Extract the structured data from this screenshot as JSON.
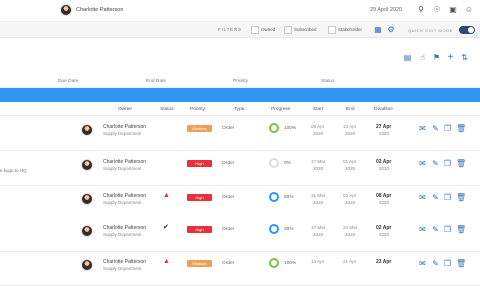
{
  "header": {
    "user_name": "Charlotte Patterson",
    "date": "29 April 2020"
  },
  "filterbar": {
    "label": "FILTERS",
    "options": [
      "Owned",
      "Subscribed",
      "Stakeholder"
    ],
    "quick_edit_label": "QUICK EDIT MODE"
  },
  "columns_strip": {
    "due_date": "Due Date",
    "end_date": "End Date",
    "priority": "Priority",
    "status": "Status"
  },
  "table": {
    "headers": {
      "owner": "Owner",
      "status": "Status",
      "priority": "Priority",
      "type": "Type",
      "progress": "Progress",
      "start": "Start",
      "end": "End",
      "deadline": "Deadline"
    },
    "rows": [
      {
        "desc": "",
        "owner": "Charlotte Patterson",
        "dept": "Supply Department",
        "status": "",
        "priority": "Medium",
        "priority_color": "#f0a05a",
        "type": "Order",
        "progress": "100%",
        "progress_ring_color": "#7bc142",
        "start": "06 Apr",
        "start_year": "2020",
        "end": "13 Apr",
        "end_year": "2020",
        "deadline": "27 Apr",
        "deadline_year": "2020"
      },
      {
        "desc": "e kugo to HQ",
        "owner": "Charlotte Patterson",
        "dept": "Supply Department",
        "status": "",
        "priority": "High",
        "priority_color": "#e8303c",
        "type": "Order",
        "progress": "0%",
        "progress_ring_color": "#dddddd",
        "start": "17 Mar",
        "start_year": "2020",
        "end": "01 Apr",
        "end_year": "2020",
        "deadline": "02 Apr",
        "deadline_year": "2020"
      },
      {
        "desc": "",
        "owner": "Charlotte Patterson",
        "dept": "Supply Department",
        "status": "▲",
        "priority": "High",
        "priority_color": "#e8303c",
        "type": "Order",
        "progress": "50%",
        "progress_ring_color": "#2f96f3",
        "start": "31 Mar",
        "start_year": "2020",
        "end": "03 Apr",
        "end_year": "2020",
        "deadline": "08 Apr",
        "deadline_year": "2020"
      },
      {
        "desc": "",
        "owner": "Charlotte Patterson",
        "dept": "Supply Department",
        "status": "✔",
        "priority": "High",
        "priority_color": "#e8303c",
        "type": "Order",
        "progress": "30%",
        "progress_ring_color": "#2f96f3",
        "start": "17 Mar",
        "start_year": "2020",
        "end": "24 Mar",
        "end_year": "2020",
        "deadline": "02 Apr",
        "deadline_year": "2020"
      },
      {
        "desc": "",
        "owner": "Charlotte Patterson",
        "dept": "Supply Department",
        "status": "▲",
        "priority": "Medium",
        "priority_color": "#f0a05a",
        "type": "Order",
        "progress": "100%",
        "progress_ring_color": "#7bc142",
        "start": "14 Apr",
        "start_year": "",
        "end": "21 Apr",
        "end_year": "",
        "deadline": "23 Apr",
        "deadline_year": ""
      }
    ]
  },
  "icons": {
    "top": [
      "search-icon",
      "bell-icon",
      "inbox-icon",
      "user-icon"
    ],
    "toolbar": [
      "list-view-icon",
      "hand-cursor-icon",
      "flag-icon",
      "add-icon",
      "sort-icon"
    ],
    "row_actions": [
      "message-icon",
      "edit-icon",
      "copy-icon",
      "delete-icon"
    ]
  }
}
